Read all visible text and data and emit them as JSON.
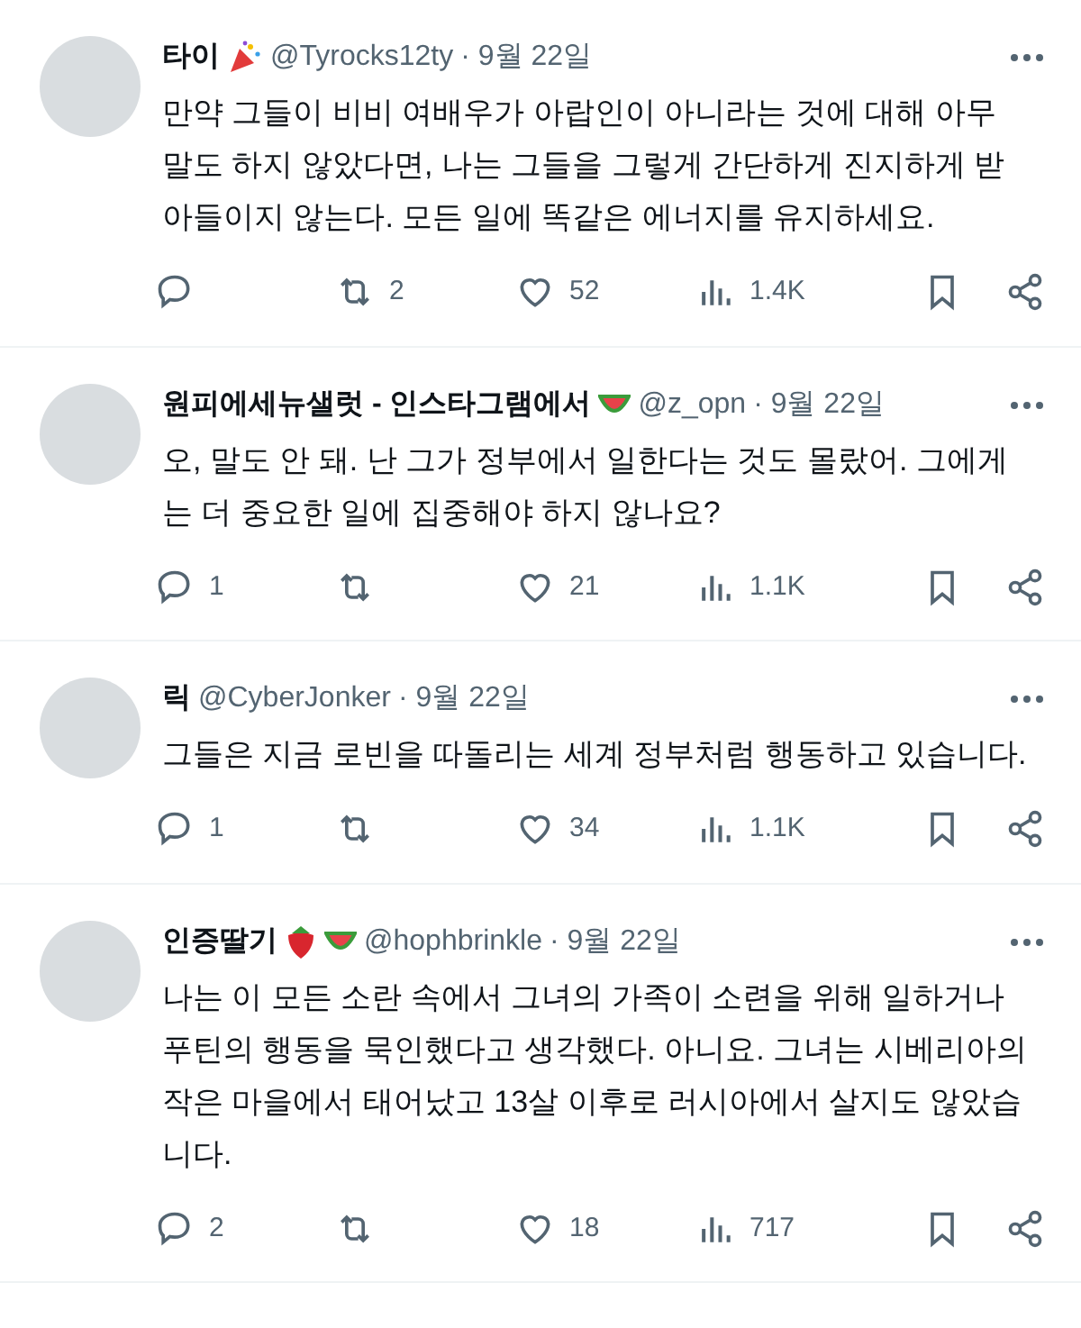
{
  "tweets": [
    {
      "name": "타이",
      "badges": [
        {
          "kind": "party"
        }
      ],
      "handle": "@Tyrocks12ty",
      "date": "· 9월 22일",
      "text": "만약 그들이 비비 여배우가 아랍인이 아니라는 것에 대해 아무 말도 하지 않았다면, 나는 그들을 그렇게 간단하게 진지하게 받아들이지 않는다. 모든 일에 똑같은 에너지를 유지하세요.",
      "retweets": "2",
      "likes": "52",
      "views": "1.4K"
    },
    {
      "name": "원피에세뉴샐럿 - 인스타그램에서",
      "badges": [
        {
          "kind": "watermelon"
        }
      ],
      "handle": "@z_opn",
      "date": "· 9월 22일",
      "text": "오, 말도 안 돼. 난 그가 정부에서 일한다는 것도 몰랐어. 그에게는 더 중요한 일에 집중해야 하지 않나요?",
      "replies": "1",
      "likes": "21",
      "views": "1.1K"
    },
    {
      "name": "릭",
      "handle": "@CyberJonker",
      "date": "· 9월 22일",
      "text": "그들은 지금 로빈을 따돌리는 세계 정부처럼 행동하고 있습니다.",
      "replies": "1",
      "likes": "34",
      "views": "1.1K"
    },
    {
      "name": "인증딸기",
      "badges": [
        {
          "kind": "strawberry"
        },
        {
          "kind": "watermelon"
        }
      ],
      "handle": "@hophbrinkle",
      "date": "· 9월 22일",
      "text": "나는 이 모든 소란 속에서 그녀의 가족이 소련을 위해 일하거나 푸틴의 행동을 묵인했다고 생각했다. 아니요. 그녀는 시베리아의 작은 마을에서 태어났고 13살 이후로 러시아에서 살지도 않았습니다.",
      "replies": "2",
      "likes": "18",
      "views": "717"
    }
  ]
}
